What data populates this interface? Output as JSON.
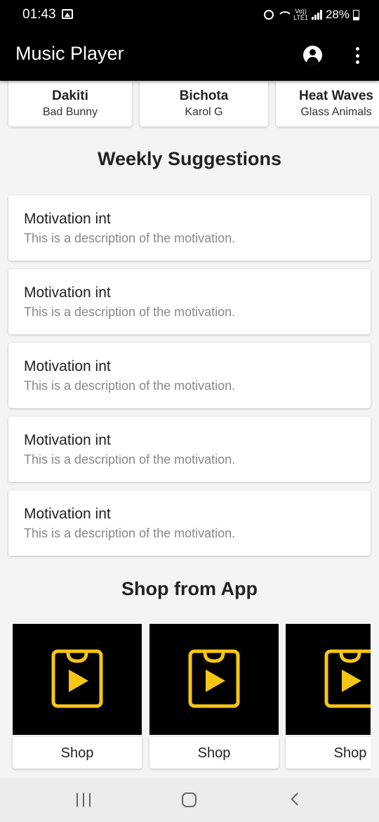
{
  "status_bar": {
    "time": "01:43",
    "volte_line1": "Vo))",
    "volte_line2": "LTE1",
    "battery": "28%",
    "icons": [
      "gallery-icon",
      "alarm-icon",
      "wifi-icon",
      "volte-icon",
      "signal-icon",
      "battery-icon"
    ]
  },
  "app_bar": {
    "title": "Music Player",
    "background": "#000000",
    "icons": [
      "account-circle-icon",
      "more-vert-icon"
    ]
  },
  "songs": [
    {
      "title": "Dakiti",
      "artist": "Bad Bunny"
    },
    {
      "title": "Bichota",
      "artist": "Karol G"
    },
    {
      "title": "Heat Waves",
      "artist": "Glass Animals"
    }
  ],
  "weekly": {
    "heading": "Weekly Suggestions",
    "items": [
      {
        "title": "Motivation int",
        "description": "This is a description of the motivation."
      },
      {
        "title": "Motivation int",
        "description": "This is a description of the motivation."
      },
      {
        "title": "Motivation int",
        "description": "This is a description of the motivation."
      },
      {
        "title": "Motivation int",
        "description": "This is a description of the motivation."
      },
      {
        "title": "Motivation int",
        "description": "This is a description of the motivation."
      }
    ]
  },
  "shop": {
    "heading": "Shop from App",
    "icon": "shopping-bag-play-icon",
    "icon_color": "#f5c518",
    "items": [
      {
        "label": "Shop"
      },
      {
        "label": "Shop"
      },
      {
        "label": "Shop"
      }
    ]
  },
  "nav_bar": {
    "icons": [
      "recents-icon",
      "home-icon",
      "back-icon"
    ]
  }
}
